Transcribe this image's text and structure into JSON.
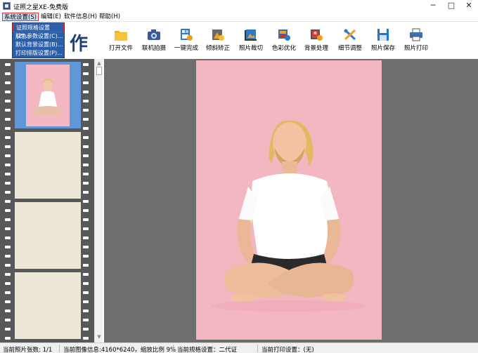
{
  "window": {
    "title": "证照之星XE-免费版",
    "minimize": "─",
    "maximize": "□",
    "close": "✕",
    "app_icon": "app-icon"
  },
  "menubar": {
    "items": [
      {
        "label": "系统设置(S)"
      },
      {
        "label": "编辑(E)"
      },
      {
        "label": "软件信息(H)"
      },
      {
        "label": "帮助(H)"
      }
    ]
  },
  "dropdown": {
    "items": [
      {
        "label": "证照规格设置(Z)..."
      },
      {
        "label": "肤色参数设置(C)..."
      },
      {
        "label": "默认背景设置(B)..."
      },
      {
        "label": "打印排版设置(P)..."
      }
    ]
  },
  "toolbar": {
    "logo_text": "作",
    "buttons": [
      {
        "label": "打开文件",
        "icon": "folder-icon"
      },
      {
        "label": "联机拍摄",
        "icon": "camera-icon"
      },
      {
        "label": "一键完成",
        "icon": "one-click-icon"
      },
      {
        "label": "倾斜矫正",
        "icon": "rotate-icon"
      },
      {
        "label": "照片裁切",
        "icon": "crop-icon"
      },
      {
        "label": "色彩优化",
        "icon": "color-icon"
      },
      {
        "label": "背景处理",
        "icon": "background-icon"
      },
      {
        "label": "细节调整",
        "icon": "tools-icon"
      },
      {
        "label": "照片保存",
        "icon": "save-icon"
      },
      {
        "label": "照片打印",
        "icon": "printer-icon"
      }
    ]
  },
  "scrollbar": {
    "up": "▲",
    "down": "▼"
  },
  "statusbar": {
    "photo_count": "当前照片张数: 1/1",
    "image_info": "当前图像信息:4160*6240，缩放比例 9%",
    "spec": "当前规格设置：二代证",
    "print": "当前打印设置：(无)"
  },
  "colors": {
    "accent_blue": "#2b5ea8",
    "highlight_red": "#e03030",
    "photo_background": "#f3b7c1",
    "canvas": "#6e6e6e",
    "filmstrip": "#58585a"
  }
}
